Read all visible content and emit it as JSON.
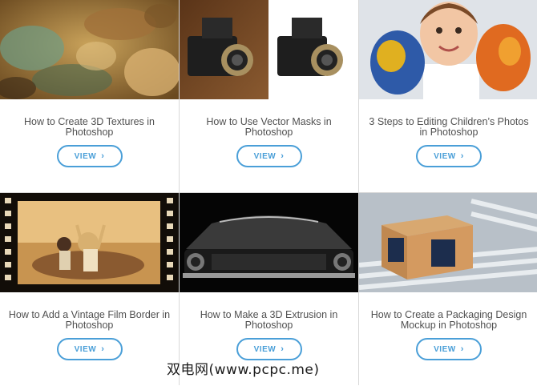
{
  "cards": [
    {
      "title": "How to Create 3D Textures in Photoshop",
      "button": "VIEW",
      "image": "rusty-texture"
    },
    {
      "title": "How to Use Vector Masks in Photoshop",
      "button": "VIEW",
      "image": "vintage-camera"
    },
    {
      "title": "3 Steps to Editing Children’s Photos in Photoshop",
      "button": "VIEW",
      "image": "child-painted-hands"
    },
    {
      "title": "How to Add a Vintage Film Border in Photoshop",
      "button": "VIEW",
      "image": "film-strip-couple"
    },
    {
      "title": "How to Make a 3D Extrusion in Photoshop",
      "button": "VIEW",
      "image": "muscle-car-front"
    },
    {
      "title": "How to Create a Packaging Design Mockup in Photoshop",
      "button": "VIEW",
      "image": "box-on-conveyor"
    }
  ],
  "watermark": "双电网(www.pcpc.me)",
  "colors": {
    "accent": "#4a9fd8",
    "title_text": "#505050",
    "divider": "#d8d8d8"
  }
}
